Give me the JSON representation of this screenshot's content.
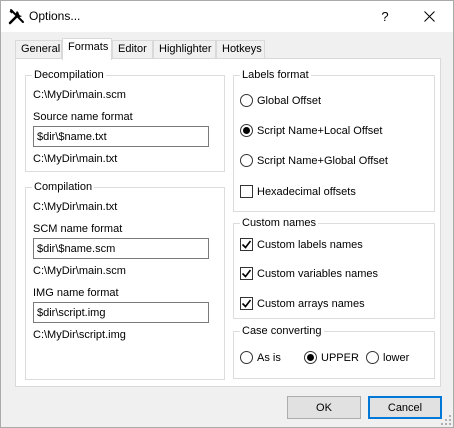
{
  "window": {
    "title": "Options...",
    "help_label": "?",
    "close_label": "✕"
  },
  "icons": {
    "app": "tools-icon"
  },
  "tabs": [
    {
      "label": "General",
      "active": false
    },
    {
      "label": "Formats",
      "active": true
    },
    {
      "label": "Editor",
      "active": false
    },
    {
      "label": "Highlighter",
      "active": false
    },
    {
      "label": "Hotkeys",
      "active": false
    }
  ],
  "decompilation": {
    "title": "Decompilation",
    "path_top": "C:\\MyDir\\main.scm",
    "source_label": "Source name format",
    "source_value": "$dir\\$name.txt",
    "path_bottom": "C:\\MyDir\\main.txt"
  },
  "compilation": {
    "title": "Compilation",
    "path_top": "C:\\MyDir\\main.txt",
    "scm_label": "SCM name format",
    "scm_value": "$dir\\$name.scm",
    "scm_path": "C:\\MyDir\\main.scm",
    "img_label": "IMG name format",
    "img_value": "$dir\\script.img",
    "img_path": "C:\\MyDir\\script.img"
  },
  "labels_format": {
    "title": "Labels format",
    "options": [
      "Global Offset",
      "Script Name+Local Offset",
      "Script Name+Global Offset"
    ],
    "selected": 1,
    "hex_label": "Hexadecimal offsets",
    "hex_checked": false
  },
  "custom_names": {
    "title": "Custom names",
    "labels": "Custom labels names",
    "variables": "Custom variables names",
    "arrays": "Custom arrays names",
    "labels_checked": true,
    "variables_checked": true,
    "arrays_checked": true
  },
  "case_converting": {
    "title": "Case converting",
    "options": [
      "As is",
      "UPPER",
      "lower"
    ],
    "selected": 1
  },
  "buttons": {
    "ok": "OK",
    "cancel": "Cancel"
  },
  "colors": {
    "accent": "#0078d7",
    "panel": "#ffffff",
    "window": "#f0f0f0"
  }
}
